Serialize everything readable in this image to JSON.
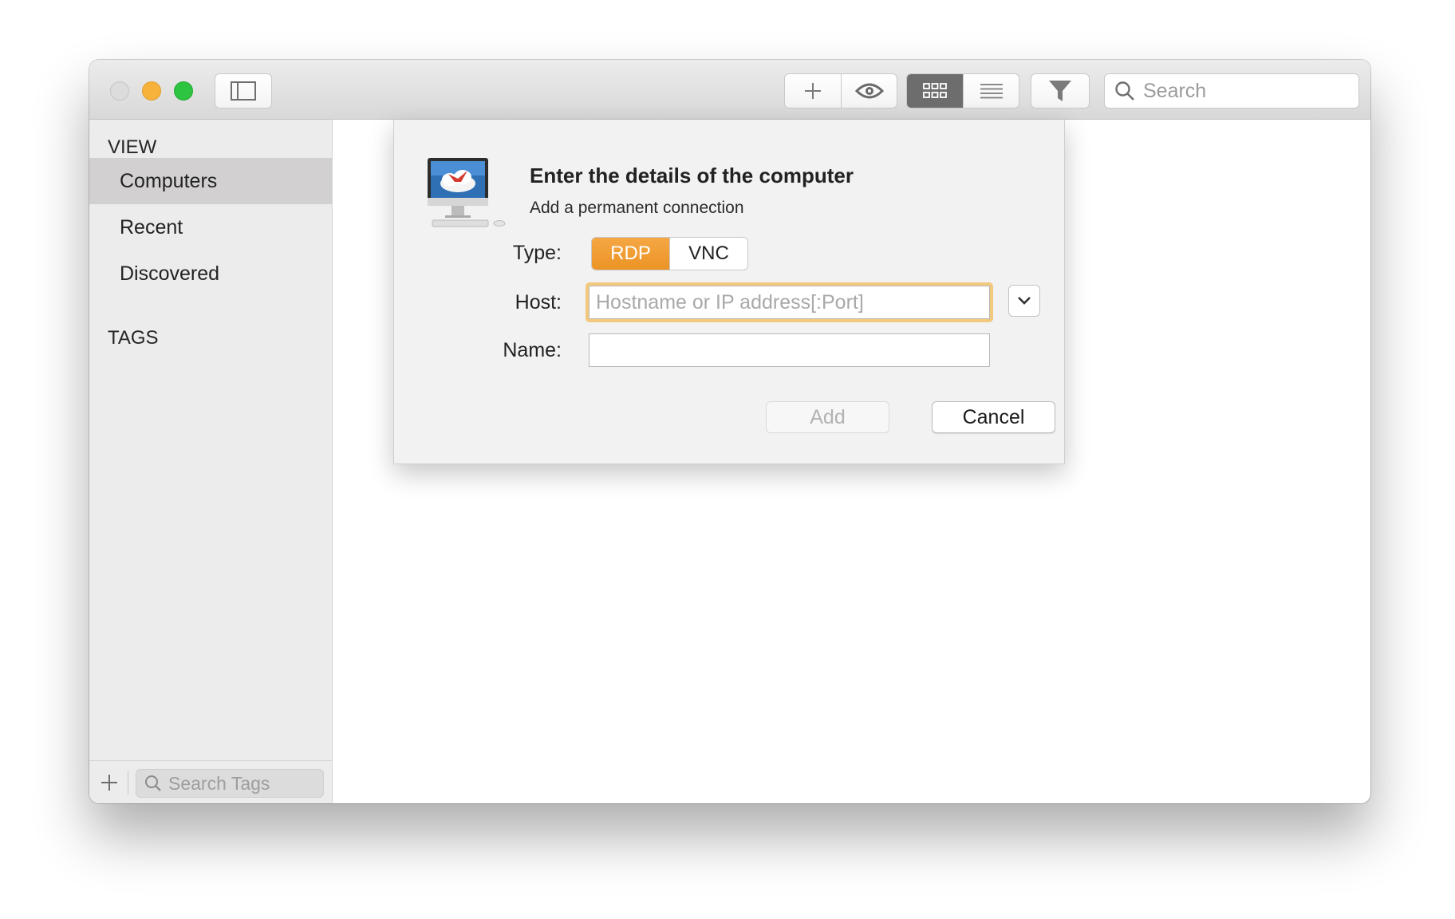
{
  "toolbar": {
    "search_placeholder": "Search",
    "icons": [
      "sidebar-toggle-icon",
      "plus-icon",
      "eye-icon",
      "grid-icon",
      "list-icon",
      "filter-icon",
      "search-icon"
    ]
  },
  "sidebar": {
    "view_title": "VIEW",
    "items": [
      {
        "label": "Computers",
        "selected": true
      },
      {
        "label": "Recent",
        "selected": false
      },
      {
        "label": "Discovered",
        "selected": false
      }
    ],
    "tags_title": "TAGS",
    "search_tags_placeholder": "Search Tags"
  },
  "dialog": {
    "title": "Enter the details of the computer",
    "subtitle": "Add a permanent connection",
    "type_label": "Type:",
    "type_options": [
      "RDP",
      "VNC"
    ],
    "type_selected": "RDP",
    "host_label": "Host:",
    "host_placeholder": "Hostname or IP address[:Port]",
    "host_value": "",
    "name_label": "Name:",
    "name_value": "",
    "add_label": "Add",
    "cancel_label": "Cancel"
  },
  "colors": {
    "accent": "#f0a035",
    "focus_ring": "#f2c97d",
    "traffic_min": "#f6b23a",
    "traffic_max": "#2dc43f",
    "selected_row": "#d2d0d0"
  }
}
